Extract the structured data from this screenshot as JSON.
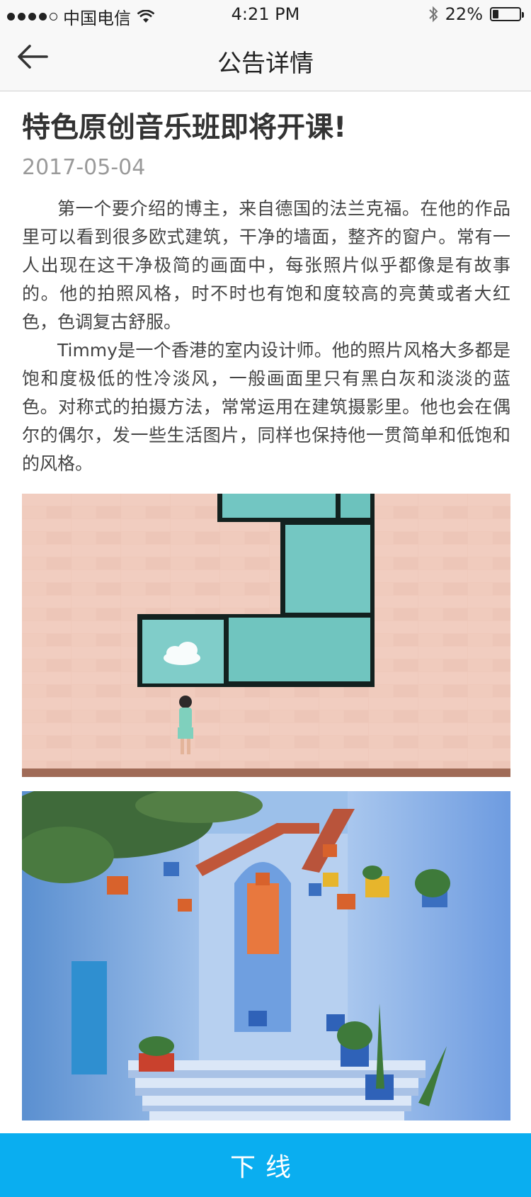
{
  "status_bar": {
    "carrier": "中国电信",
    "time": "4:21 PM",
    "battery": "22%",
    "battery_level": 0.22,
    "signal_bars": 4
  },
  "nav": {
    "title": "公告详情",
    "back_icon": "arrow-left-icon"
  },
  "article": {
    "title": "特色原创音乐班即将开课!",
    "date": "2017-05-04",
    "paragraphs": [
      "第一个要介绍的博主，来自德国的法兰克福。在他的作品里可以看到很多欧式建筑，干净的墙面，整齐的窗户。常有一人出现在这干净极简的画面中，每张照片似乎都像是有故事的。他的拍照风格，时不时也有饱和度较高的亮黄或者大红色，色调复古舒服。",
      "Timmy是一个香港的室内设计师。他的照片风格大多都是饱和度极低的性冷淡风，一般画面里只有黑白灰和淡淡的蓝色。对称式的拍摄方法，常常运用在建筑摄影里。他也会在偶尔的偶尔，发一些生活图片，同样也保持他一贯简单和低饱和的风格。"
    ]
  },
  "bottom_button": {
    "label": "下线",
    "color": "#0aaef0"
  }
}
